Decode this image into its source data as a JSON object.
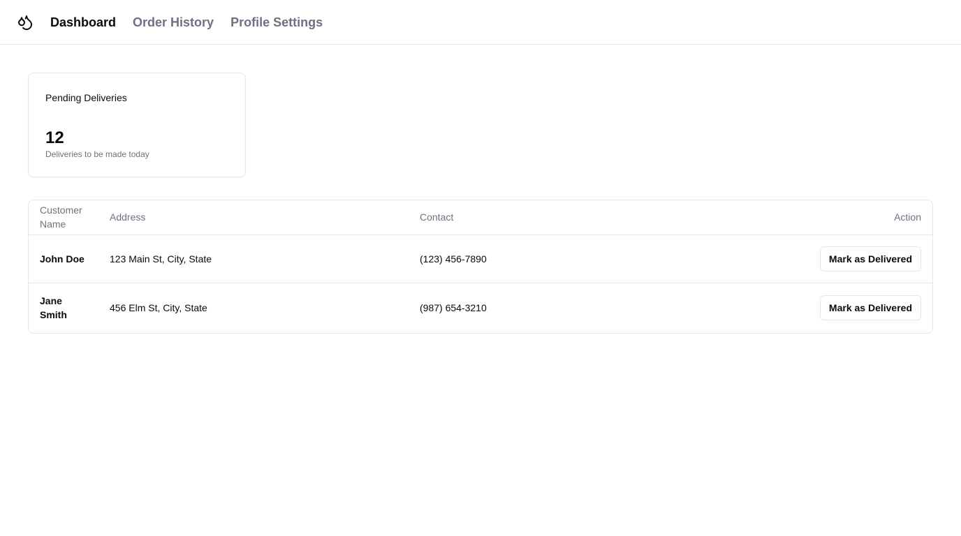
{
  "nav": {
    "logo_icon": "droplets-icon",
    "items": [
      {
        "label": "Dashboard",
        "active": true
      },
      {
        "label": "Order History",
        "active": false
      },
      {
        "label": "Profile Settings",
        "active": false
      }
    ]
  },
  "summary_card": {
    "title": "Pending Deliveries",
    "value": "12",
    "description": "Deliveries to be made today"
  },
  "table": {
    "headers": {
      "name": "Customer Name",
      "address": "Address",
      "contact": "Contact",
      "action": "Action"
    },
    "rows": [
      {
        "name": "John Doe",
        "address": "123 Main St, City, State",
        "contact": "(123) 456-7890",
        "action_label": "Mark as Delivered"
      },
      {
        "name": "Jane Smith",
        "address": "456 Elm St, City, State",
        "contact": "(987) 654-3210",
        "action_label": "Mark as Delivered"
      }
    ]
  },
  "colors": {
    "text_primary": "#0a0a0a",
    "text_muted": "#6b7280",
    "border": "#e5e7eb",
    "background": "#ffffff"
  }
}
